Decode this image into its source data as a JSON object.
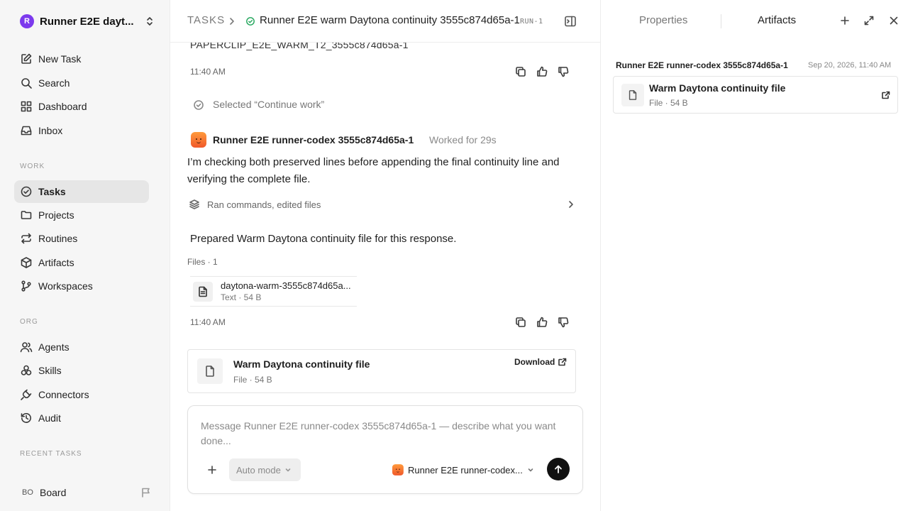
{
  "workspace": {
    "logo": "R",
    "name": "Runner E2E dayt..."
  },
  "nav_top": [
    {
      "label": "New Task",
      "icon": "edit-icon"
    },
    {
      "label": "Search",
      "icon": "search-icon"
    },
    {
      "label": "Dashboard",
      "icon": "dashboard-icon"
    },
    {
      "label": "Inbox",
      "icon": "inbox-icon"
    }
  ],
  "sections": {
    "work": "WORK",
    "org": "ORG",
    "recent": "RECENT TASKS"
  },
  "nav_work": [
    {
      "label": "Tasks",
      "icon": "check-circle-icon",
      "active": true
    },
    {
      "label": "Projects",
      "icon": "folder-icon"
    },
    {
      "label": "Routines",
      "icon": "repeat-icon"
    },
    {
      "label": "Artifacts",
      "icon": "box-icon"
    },
    {
      "label": "Workspaces",
      "icon": "branch-icon"
    }
  ],
  "nav_org": [
    {
      "label": "Agents",
      "icon": "users-icon"
    },
    {
      "label": "Skills",
      "icon": "skills-icon"
    },
    {
      "label": "Connectors",
      "icon": "plug-icon"
    },
    {
      "label": "Audit",
      "icon": "history-icon"
    }
  ],
  "board": {
    "initials": "BO",
    "label": "Board"
  },
  "header": {
    "root": "TASKS",
    "title": "Runner E2E warm Daytona continuity 3555c874d65a-1",
    "run_id": "RUN-1"
  },
  "thread": {
    "prev_text": "PAPERCLIP_E2E_WARM_T2_3555c874d65a-1",
    "time1": "11:40 AM",
    "selected": "Selected “Continue work”",
    "agent_name": "Runner E2E runner-codex 3555c874d65a-1",
    "worked": "Worked for 29s",
    "message": "I’m checking both preserved lines before appending the final continuity line and verifying the complete file.",
    "activity": "Ran commands, edited files",
    "prepared": "Prepared Warm Daytona continuity file for this response.",
    "files_label": "Files · 1",
    "file_name": "daytona-warm-3555c874d65a...",
    "file_meta": "Text · 54 B",
    "time2": "11:40 AM",
    "card_title": "Warm Daytona continuity file",
    "card_meta": "File · 54 B",
    "download": "Download"
  },
  "composer": {
    "placeholder": "Message Runner E2E runner-codex 3555c874d65a-1 — describe what you want done...",
    "mode": "Auto mode",
    "agent": "Runner E2E runner-codex..."
  },
  "right_panel": {
    "tab_properties": "Properties",
    "tab_artifacts": "Artifacts",
    "group_title": "Runner E2E runner-codex 3555c874d65a-1",
    "group_date": "Sep 20, 2026, 11:40 AM",
    "artifact_title": "Warm Daytona continuity file",
    "artifact_meta": "File · 54 B"
  },
  "colors": {
    "brand": "#7c3aed",
    "status_green": "#22a55b",
    "send": "#111111"
  }
}
